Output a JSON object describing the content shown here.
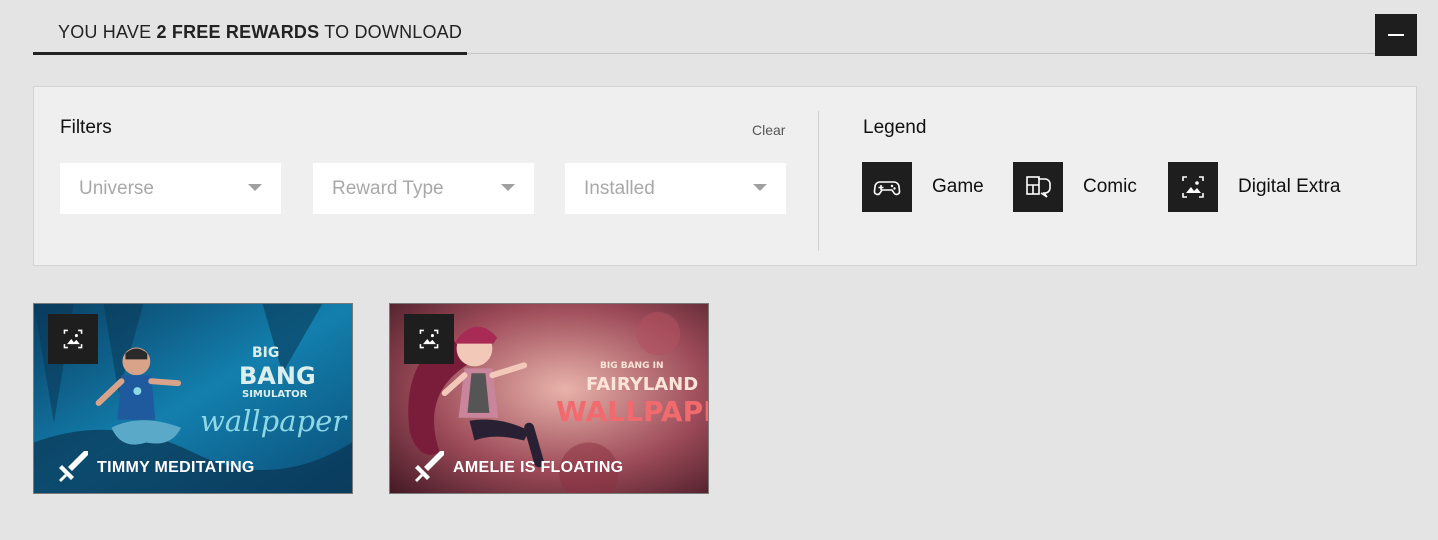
{
  "header": {
    "title_prefix": "YOU HAVE ",
    "title_bold": "2 FREE REWARDS",
    "title_suffix": " TO DOWNLOAD",
    "collapse_icon": "minus-icon"
  },
  "filters": {
    "title": "Filters",
    "clear_label": "Clear",
    "dropdowns": [
      {
        "label": "Universe"
      },
      {
        "label": "Reward Type"
      },
      {
        "label": "Installed"
      }
    ]
  },
  "legend": {
    "title": "Legend",
    "items": [
      {
        "label": "Game",
        "icon": "gamepad-icon"
      },
      {
        "label": "Comic",
        "icon": "comic-icon"
      },
      {
        "label": "Digital Extra",
        "icon": "image-icon"
      }
    ]
  },
  "rewards": [
    {
      "title": "TIMMY MEDITATING",
      "type_icon": "image-icon",
      "art_line1": "BIG",
      "art_line2": "BANG",
      "art_line3": "SIMULATOR",
      "art_word": "wallpaper",
      "colors": {
        "bg": "#0e5d86",
        "bg2": "#1b8fb8",
        "text": "#8fd8e6"
      }
    },
    {
      "title": "AMELIE IS FLOATING",
      "type_icon": "image-icon",
      "art_line1": "BIG BANG IN",
      "art_line2": "FAIRYLAND",
      "art_word": "WALLPAPER",
      "colors": {
        "bg": "#6a2a3a",
        "bg2": "#c88a90",
        "text": "#f06a6e"
      }
    }
  ],
  "colors": {
    "accent": "#1e1e1e",
    "page_bg": "#e4e4e4",
    "panel_bg": "#efefef"
  }
}
